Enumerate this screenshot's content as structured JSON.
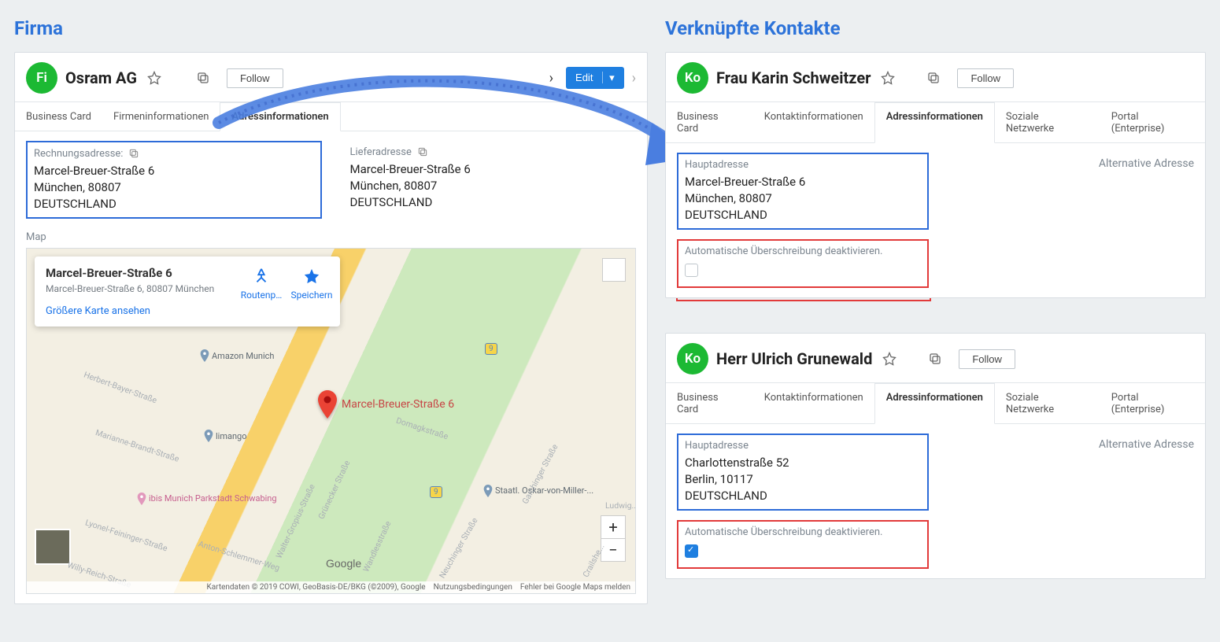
{
  "headings": {
    "company": "Firma",
    "contacts": "Verknüpfte Kontakte"
  },
  "company": {
    "chip": "Fi",
    "title": "Osram AG",
    "follow": "Follow",
    "edit": "Edit",
    "tabs": [
      "Business Card",
      "Firmeninformationen",
      "Adressinformationen"
    ],
    "billing": {
      "label": "Rechnungsadresse:",
      "street": "Marcel-Breuer-Straße 6",
      "city_zip": "München,  80807",
      "country": "DEUTSCHLAND"
    },
    "shipping": {
      "label": "Lieferadresse",
      "street": "Marcel-Breuer-Straße 6",
      "city_zip": "München,  80807",
      "country": "DEUTSCHLAND"
    },
    "map_label": "Map",
    "map": {
      "title": "Marcel-Breuer-Straße 6",
      "subtitle": "Marcel-Breuer-Straße 6, 80807 München",
      "route": "Routenp…",
      "save": "Speichern",
      "larger": "Größere Karte ansehen",
      "pin_label": "Marcel-Breuer-Straße 6",
      "google": "Google",
      "attrib1": "Kartendaten © 2019 COWI, GeoBasis-DE/BKG (©2009), Google",
      "attrib2": "Nutzungsbedingungen",
      "attrib3": "Fehler bei Google Maps melden",
      "pois": {
        "amazon": "Amazon Munich",
        "limango": "limango",
        "ibis": "ibis Munich Parkstadt Schwabing",
        "oskar": "Staatl. Oskar-von-Miller-..."
      },
      "roads": {
        "herbert": "Herbert-Bayer-Straße",
        "marianne": "Marianne-Brandt-Straße",
        "lyonel": "Lyonel-Feininger-Straße",
        "willyreich": "Willy-Reich-Straße",
        "anton": "Anton-Schlemmer-Weg",
        "wandles": "Wandlesstraße",
        "gropius": "Walter-Gropius-Straße",
        "gruneck": "Grünecker Straße",
        "domagk": "Domagkstraße",
        "neuchinger": "Neuchinger Straße",
        "garchinger": "Garchinger Straße",
        "ludwig": "Ludwig...",
        "crails": "Crailshe..."
      },
      "route_num": "9"
    }
  },
  "contacts": [
    {
      "chip": "Ko",
      "title": "Frau Karin Schweitzer",
      "follow": "Follow",
      "tabs": [
        "Business Card",
        "Kontaktinformationen",
        "Adressinformationen",
        "Soziale Netzwerke",
        "Portal (Enterprise)"
      ],
      "main_label": "Hauptadresse",
      "alt_label": "Alternative Adresse",
      "street": "Marcel-Breuer-Straße 6",
      "city_zip": "München,  80807",
      "country": "DEUTSCHLAND",
      "overwrite_label": "Automatische Überschreibung deaktivieren.",
      "overwrite_checked": false
    },
    {
      "chip": "Ko",
      "title": "Herr Ulrich Grunewald",
      "follow": "Follow",
      "tabs": [
        "Business Card",
        "Kontaktinformationen",
        "Adressinformationen",
        "Soziale Netzwerke",
        "Portal (Enterprise)"
      ],
      "main_label": "Hauptadresse",
      "alt_label": "Alternative Adresse",
      "street": "Charlottenstraße 52",
      "city_zip": "Berlin,  10117",
      "country": "DEUTSCHLAND",
      "overwrite_label": "Automatische Überschreibung deaktivieren.",
      "overwrite_checked": true
    }
  ]
}
